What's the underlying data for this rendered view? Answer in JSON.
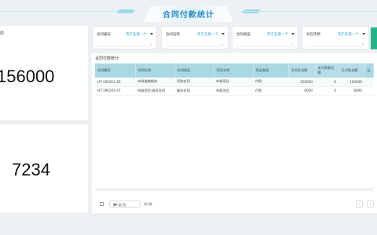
{
  "header": {
    "title": "合同付款统计"
  },
  "stats": {
    "card1": {
      "label": "额",
      "value": "156000"
    },
    "card2": {
      "value": "7234"
    }
  },
  "filters": [
    {
      "label": "合同编号",
      "value": "等于任意一个"
    },
    {
      "label": "合同名称",
      "value": "等于任意一个"
    },
    {
      "label": "合同类型",
      "value": "等于任意一个"
    },
    {
      "label": "对应项目",
      "value": "等于任意一个"
    }
  ],
  "table": {
    "title": "合同付款统计",
    "columns": [
      "合同编号",
      "合同名称",
      "合同类型",
      "项目名称",
      "资金类型",
      "合同总金额",
      "未付款数金额",
      "已付款金额",
      "日"
    ],
    "rows": [
      [
        "HT-190311-05",
        "市政道路服务",
        "采购合同",
        "市政项目",
        "付款",
        "150000",
        "0",
        "150000",
        ""
      ],
      [
        "HT-190201-07",
        "市政项目-服务合同",
        "服务合同",
        "市政项目",
        "付款",
        "6000",
        "0",
        "6000",
        ""
      ]
    ]
  },
  "pager": {
    "page_size": "20 条/页",
    "total": "共2条",
    "prev": "‹",
    "next": "›"
  },
  "colors": {
    "accent": "#2aa3d6",
    "header_table": "#a9d7e2",
    "green_button": "#25b48c"
  }
}
